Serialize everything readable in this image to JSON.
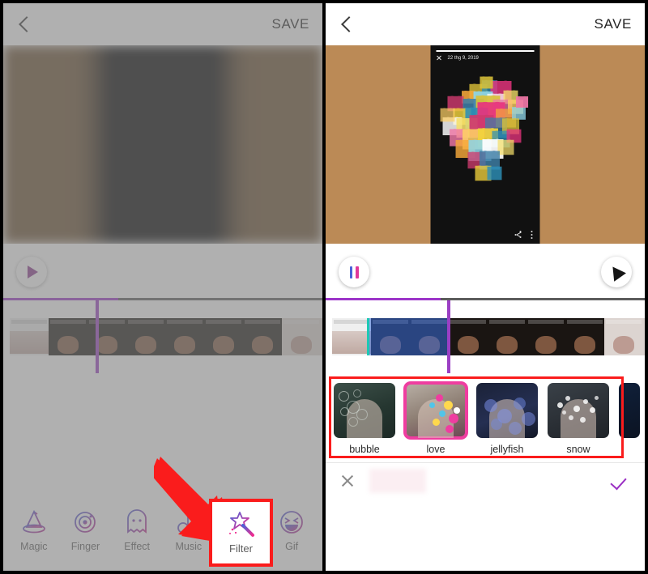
{
  "app": {
    "panels": [
      "before",
      "after"
    ]
  },
  "header": {
    "back_icon": "back-chevron-icon",
    "save_label": "SAVE"
  },
  "preview": {
    "background_color": "#bb8a56",
    "screen_background": "#111111",
    "date_label": "22 thg 9, 2019",
    "close_icon": "close-icon",
    "share_icon": "share-icon",
    "more_icon": "more-vertical-icon",
    "hearts_effect": "love-hearts-overlay"
  },
  "transport": {
    "left_play_icon": "play-icon",
    "right_pause_icon": "pause-icon",
    "cursor_icon": "cursor-arrow-icon",
    "progress_percent": 36,
    "progress_fill_color": "#9c35c9",
    "progress_track_color": "#5c5c5c"
  },
  "timeline": {
    "playhead_color": "#9b3fc4",
    "selection_color": "#386edc",
    "handle_color": "#1ec8b4",
    "left_playhead_percent": 29,
    "right_playhead_percent": 38,
    "selection_start_percent": 13,
    "selection_width_percent": 25
  },
  "filters": {
    "accent_selected_color": "#ef3da0",
    "highlight_box_color": "#fa1c1c",
    "items": [
      {
        "label": "bubble",
        "icon": "filter-thumb-bubble",
        "selected": false
      },
      {
        "label": "love",
        "icon": "filter-thumb-love",
        "selected": true
      },
      {
        "label": "jellyfish",
        "icon": "filter-thumb-jellyfish",
        "selected": false
      },
      {
        "label": "snow",
        "icon": "filter-thumb-snow",
        "selected": false
      }
    ]
  },
  "confirm_bar": {
    "cancel_icon": "close-icon",
    "accept_icon": "check-icon",
    "accept_color": "#9b30c4"
  },
  "toolbar": {
    "items": [
      {
        "label": "Magic",
        "icon": "wizard-hat-icon"
      },
      {
        "label": "Finger",
        "icon": "finger-swirl-icon"
      },
      {
        "label": "Effect",
        "icon": "ghost-face-icon"
      },
      {
        "label": "Music",
        "icon": "music-note-icon"
      },
      {
        "label": "Filter",
        "icon": "magic-wand-icon"
      },
      {
        "label": "Gif",
        "icon": "smiley-face-icon"
      }
    ],
    "highlighted_label": "Filter",
    "annotation_icon": "red-arrow-icon"
  }
}
